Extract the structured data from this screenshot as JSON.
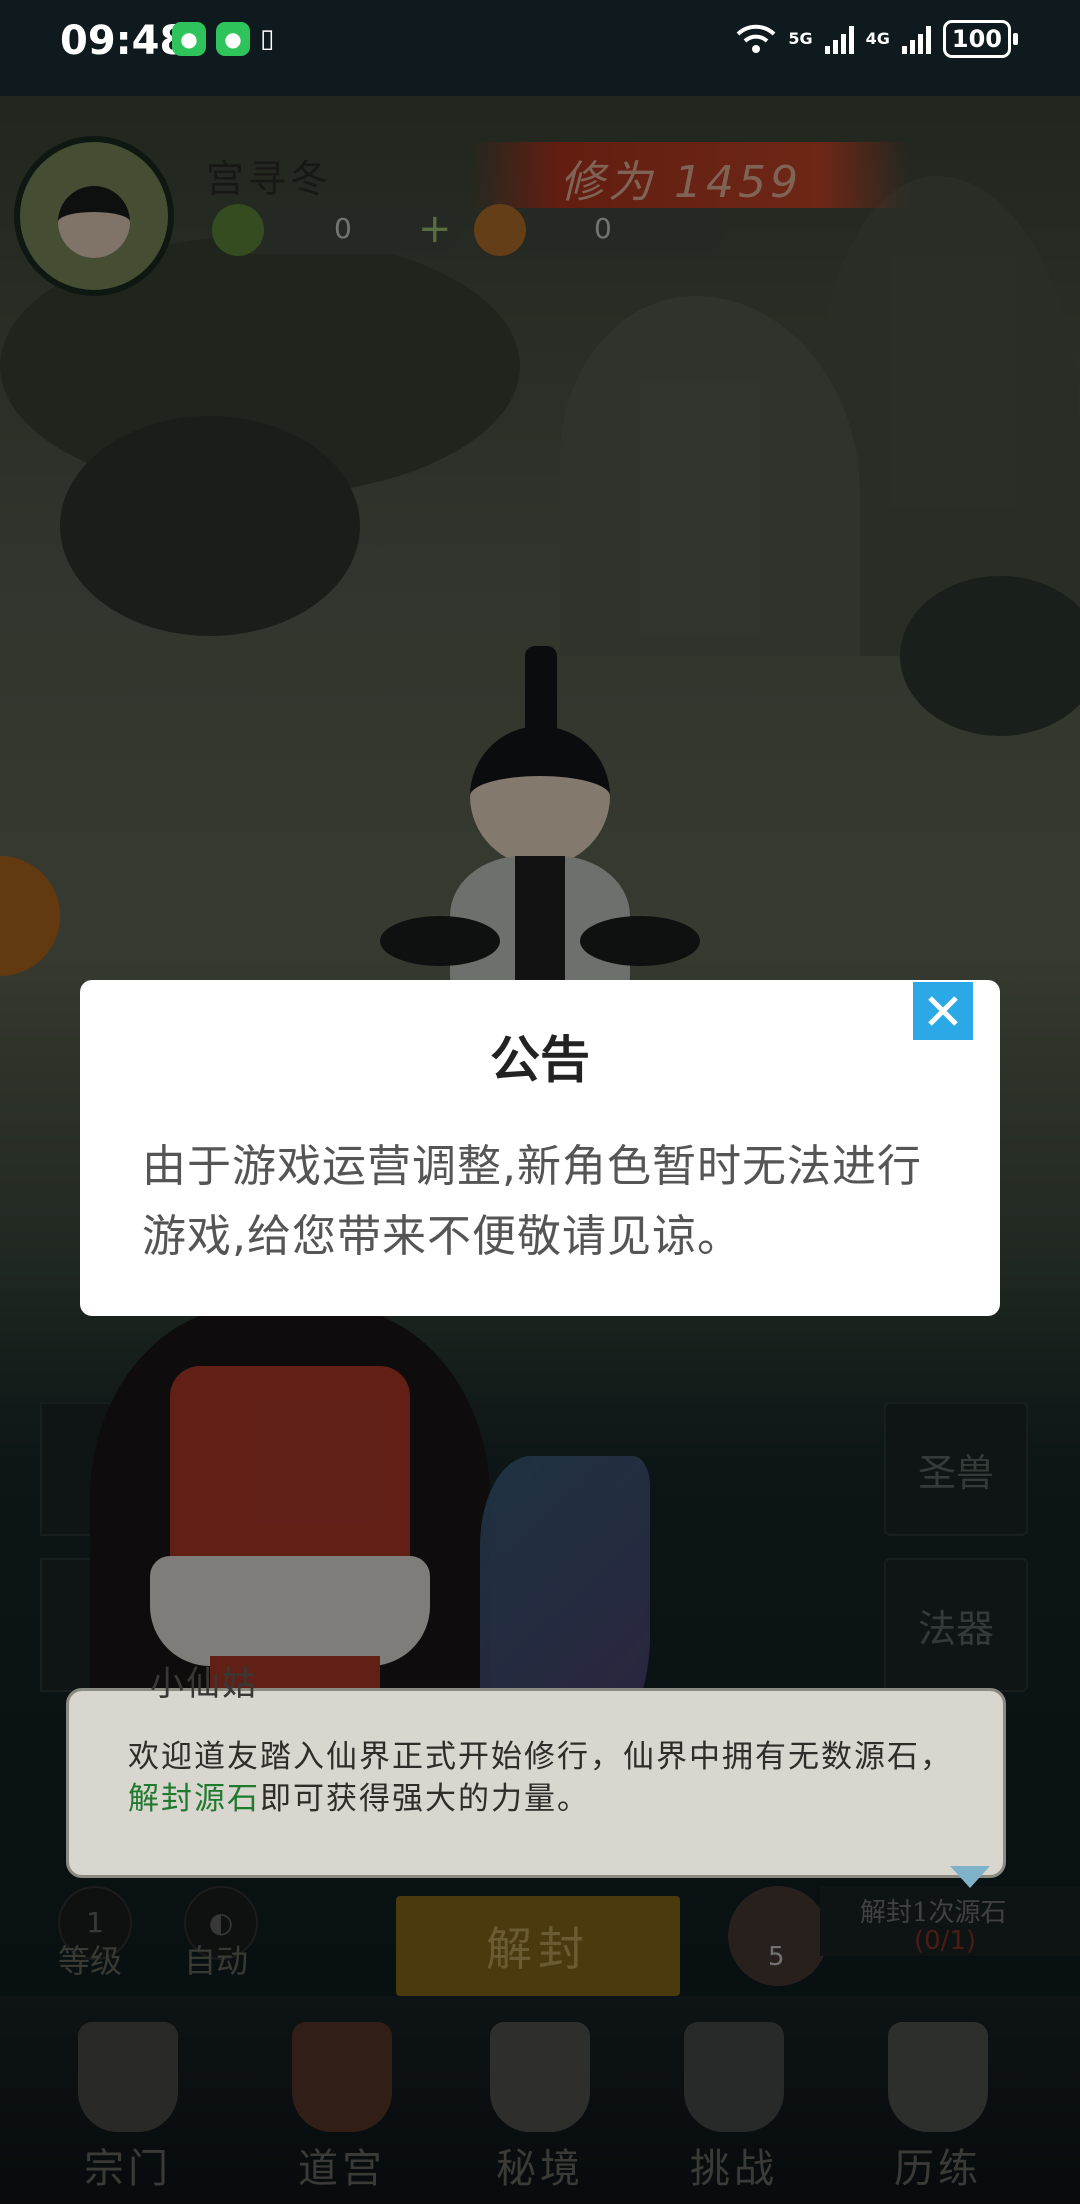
{
  "status_bar": {
    "time": "09:48",
    "network_5g": "5G",
    "network_4g": "4G",
    "battery": "100"
  },
  "player": {
    "name": "宫寻冬",
    "cultivation": "修为 1459",
    "jade": "0",
    "spirit": "0"
  },
  "side_buttons": {
    "holy_beast": "圣兽",
    "artifact": "法器"
  },
  "npc_dialogue": {
    "speaker": "小仙姑",
    "text_before": "欢迎道友踏入仙界正式开始修行，仙界中拥有无数源石，",
    "highlight": "解封源石",
    "text_after": "即可获得强大的力量。"
  },
  "controls": {
    "level": "等级",
    "auto": "自动",
    "unlock": "解封",
    "stone_count": "5",
    "quest_label": "解封1次源石",
    "quest_progress": "(0/1)"
  },
  "bottom_nav": [
    {
      "label": "宗门"
    },
    {
      "label": "道宫"
    },
    {
      "label": "秘境"
    },
    {
      "label": "挑战"
    },
    {
      "label": "历练"
    }
  ],
  "modal": {
    "title": "公告",
    "body": "由于游戏运营调整,新角色暂时无法进行游戏,给您带来不便敬请见谅。",
    "close_icon": "close-icon"
  },
  "colors": {
    "accent_close": "#2aa9e6",
    "highlight_green": "#1f7a2e"
  }
}
